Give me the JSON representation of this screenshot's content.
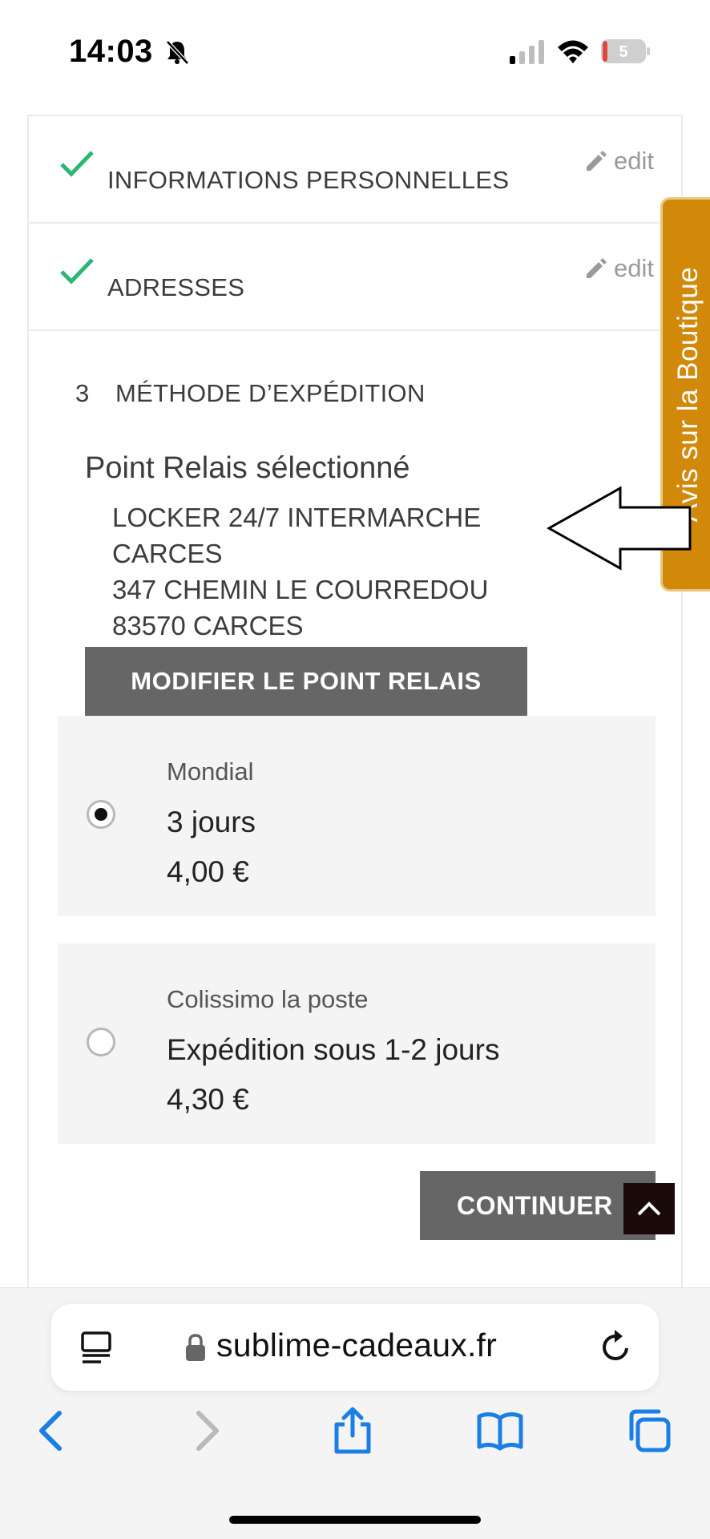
{
  "status_bar": {
    "time": "14:03",
    "battery_level": "5"
  },
  "checkout": {
    "steps": [
      {
        "title": "INFORMATIONS PERSONNELLES",
        "edit_label": "edit"
      },
      {
        "title": "ADRESSES",
        "edit_label": "edit"
      }
    ],
    "current_step": {
      "number": "3",
      "title": "MÉTHODE D’EXPÉDITION"
    },
    "relay": {
      "heading": "Point Relais sélectionné",
      "lines": [
        "LOCKER 24/7 INTERMARCHE",
        "CARCES",
        "347 CHEMIN LE COURREDOU",
        "83570 CARCES"
      ],
      "modify_label": "MODIFIER LE POINT RELAIS"
    },
    "carriers": [
      {
        "name": "Mondial",
        "delay": "3 jours",
        "price": "4,00 €",
        "selected": true
      },
      {
        "name": "Colissimo la poste",
        "delay": "Expédition sous 1-2 jours",
        "price": "4,30 €",
        "selected": false
      }
    ],
    "continue_label": "CONTINUER"
  },
  "review_tab": {
    "label": "Avis sur la Boutique",
    "color": "#d2890a"
  },
  "browser": {
    "domain": "sublime-cadeaux.fr",
    "accent": "#1a7ee6"
  }
}
